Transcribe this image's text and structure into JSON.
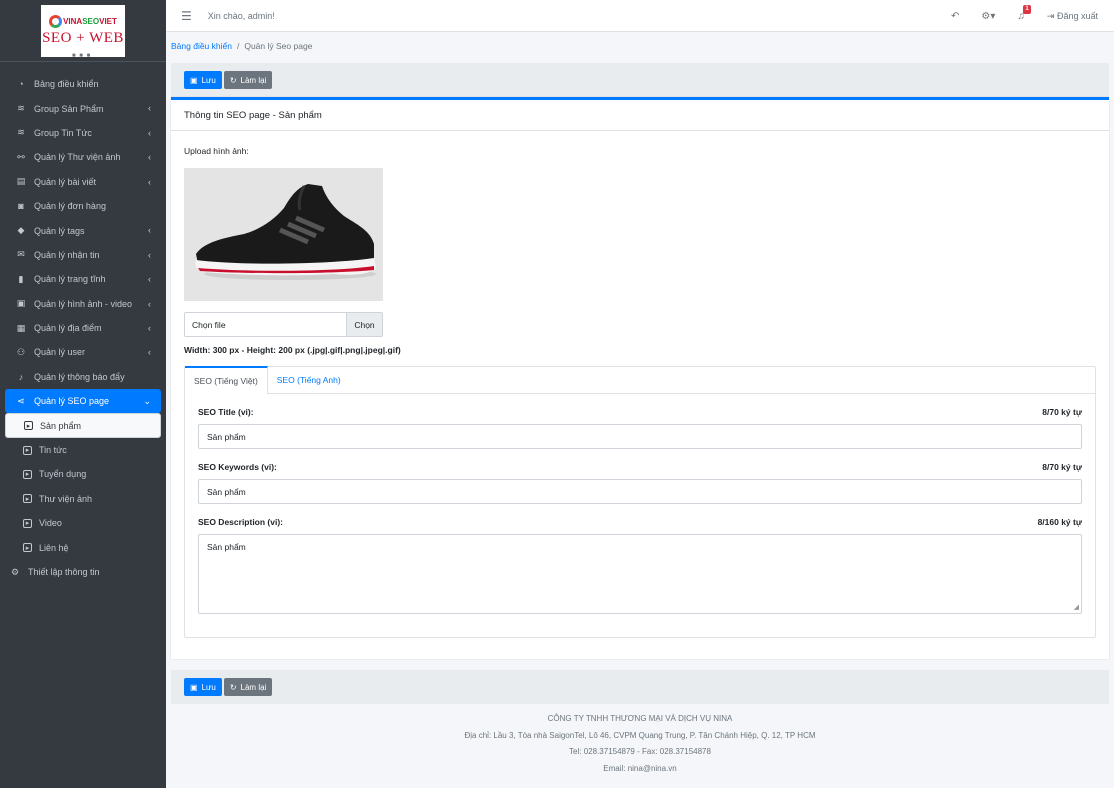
{
  "brand": {
    "logo_vina": "VINA",
    "logo_seo": "SEO",
    "logo_viet": "VIET",
    "logo_bottom": "SEO + WEB"
  },
  "sidebar": {
    "items": [
      {
        "label": "Bảng điều khiển",
        "icon": "tachometer-icon",
        "glyph": "◔",
        "chevron": false
      },
      {
        "label": "Group Sản Phẩm",
        "icon": "layers-icon",
        "glyph": "≋",
        "chevron": true
      },
      {
        "label": "Group Tin Tức",
        "icon": "layers-icon",
        "glyph": "≋",
        "chevron": true
      },
      {
        "label": "Quản lý Thư viện ảnh",
        "icon": "sitemap-icon",
        "glyph": "⚯",
        "chevron": true
      },
      {
        "label": "Quản lý bài viết",
        "icon": "newspaper-icon",
        "glyph": "▤",
        "chevron": true
      },
      {
        "label": "Quản lý đơn hàng",
        "icon": "shopping-bag-icon",
        "glyph": "◙",
        "chevron": false
      },
      {
        "label": "Quản lý tags",
        "icon": "tags-icon",
        "glyph": "◆",
        "chevron": true
      },
      {
        "label": "Quản lý nhận tin",
        "icon": "envelope-icon",
        "glyph": "✉",
        "chevron": true
      },
      {
        "label": "Quản lý trang tĩnh",
        "icon": "bookmark-icon",
        "glyph": "▮",
        "chevron": true
      },
      {
        "label": "Quản lý hình ảnh - video",
        "icon": "photo-video-icon",
        "glyph": "▣",
        "chevron": true
      },
      {
        "label": "Quản lý địa điểm",
        "icon": "building-icon",
        "glyph": "▦",
        "chevron": true
      },
      {
        "label": "Quản lý user",
        "icon": "users-icon",
        "glyph": "⚇",
        "chevron": true
      },
      {
        "label": "Quản lý thông báo đẩy",
        "icon": "bell-icon",
        "glyph": "♪",
        "chevron": false
      },
      {
        "label": "Quản lý SEO page",
        "icon": "share-icon",
        "glyph": "⋖",
        "chevron": true,
        "active": true
      }
    ],
    "subitems": [
      {
        "label": "Sản phẩm",
        "active": true
      },
      {
        "label": "Tin tức"
      },
      {
        "label": "Tuyển dụng"
      },
      {
        "label": "Thư viện ảnh"
      },
      {
        "label": "Video"
      },
      {
        "label": "Liên hệ"
      }
    ],
    "last_item": {
      "label": "Thiết lập thông tin",
      "icon": "cogs-icon"
    }
  },
  "topbar": {
    "greeting": "Xin chào, admin!",
    "notification_count": "1",
    "logout_label": "Đăng xuất"
  },
  "breadcrumb": {
    "home": "Bảng điều khiển",
    "current": "Quản lý Seo page"
  },
  "actions": {
    "save_label": "Lưu",
    "reset_label": "Làm lại"
  },
  "card": {
    "title": "Thông tin SEO page - Sản phẩm",
    "upload_label": "Upload hình ảnh:",
    "file_placeholder": "Chọn file",
    "file_button": "Chọn",
    "size_note": "Width: 300 px - Height: 200 px (.jpg|.gif|.png|.jpeg|.gif)"
  },
  "tabs": [
    {
      "label": "SEO (Tiếng Việt)",
      "active": true
    },
    {
      "label": "SEO (Tiếng Anh)",
      "active": false
    }
  ],
  "seo_fields": {
    "title": {
      "label": "SEO Title (vi):",
      "count": "8/70 ký tự",
      "value": "Sản phẩm"
    },
    "keywords": {
      "label": "SEO Keywords (vi):",
      "count": "8/70 ký tự",
      "value": "Sản phẩm"
    },
    "description": {
      "label": "SEO Description (vi):",
      "count": "8/160 ký tự",
      "value": "Sản phẩm"
    }
  },
  "footer": {
    "company": "CÔNG TY TNHH THƯƠNG MẠI VÀ DỊCH VỤ NINA",
    "address": "Địa chỉ: Lầu 3, Tòa nhà SaigonTel, Lô 46, CVPM Quang Trung, P. Tân Chánh Hiệp, Q. 12, TP HCM",
    "phone": "Tel: 028.37154879 - Fax: 028.37154878",
    "email": "Email: nina@nina.vn"
  },
  "colors": {
    "primary": "#007bff",
    "sidebar_bg": "#343a40",
    "secondary": "#6c757d",
    "badge": "#dc3545"
  }
}
